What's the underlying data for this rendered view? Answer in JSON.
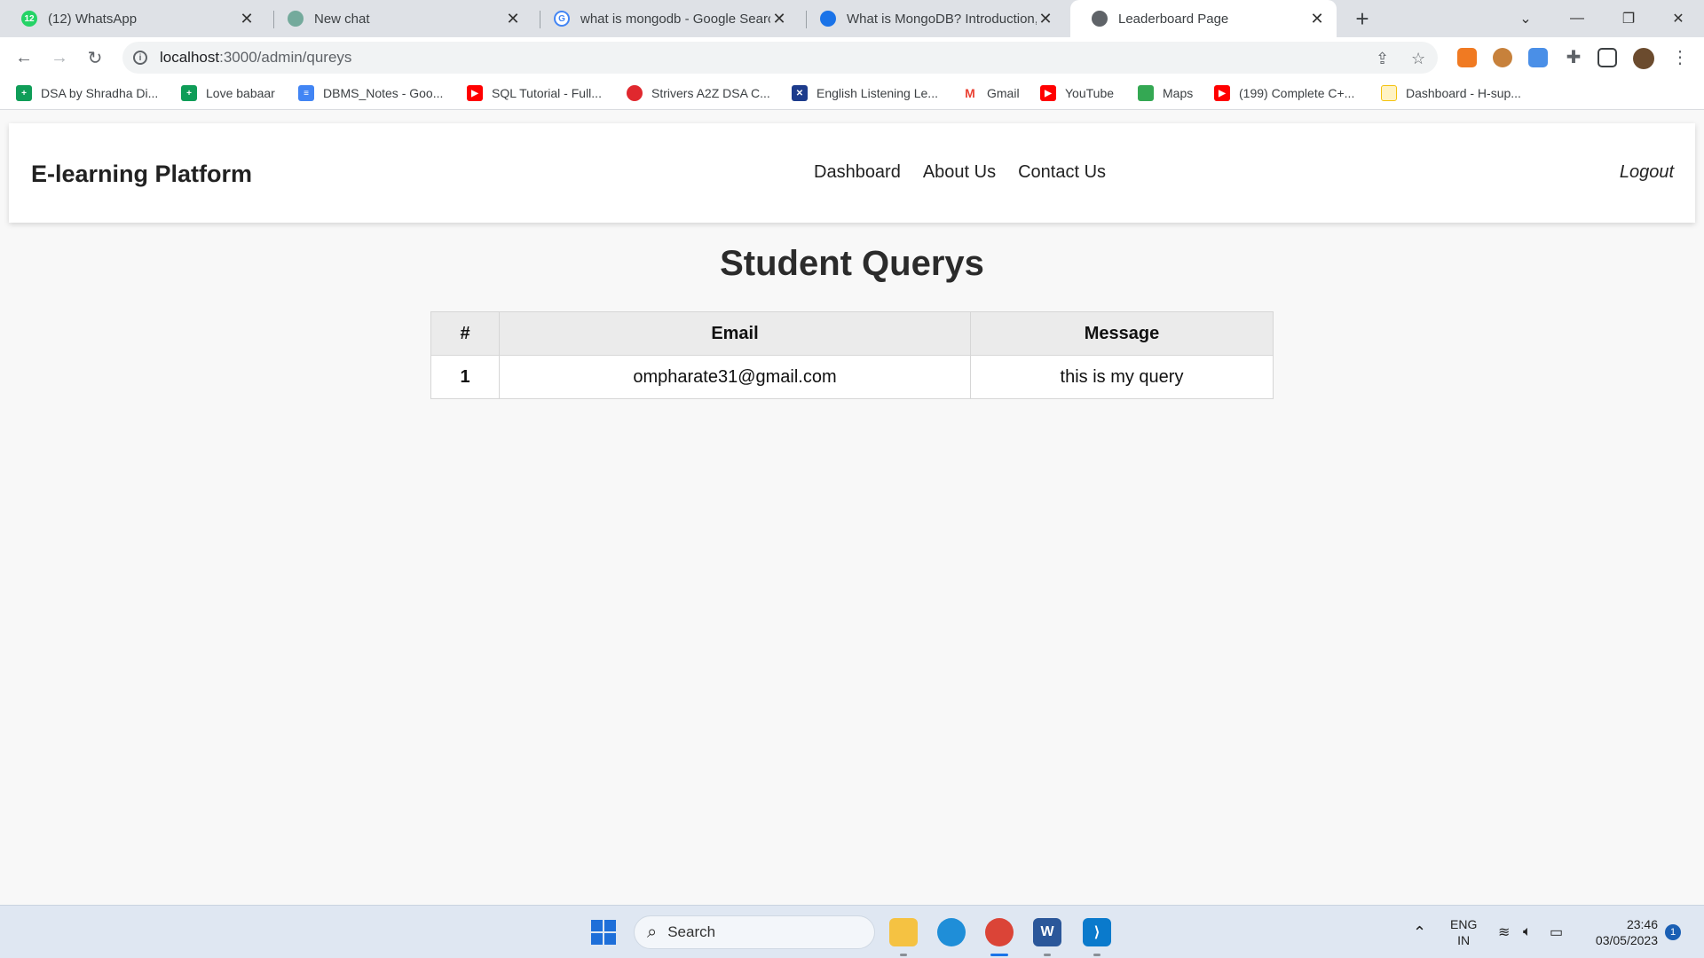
{
  "browser": {
    "tabs": [
      {
        "title": "(12) WhatsApp",
        "icon": "whatsapp-icon",
        "badge": "12",
        "color": "#25d366"
      },
      {
        "title": "New chat",
        "icon": "chatgpt-icon",
        "color": "#74aa9c"
      },
      {
        "title": "what is mongodb - Google Searc",
        "icon": "google-icon",
        "color": "#4285f4"
      },
      {
        "title": "What is MongoDB? Introduction,",
        "icon": "mongodb-site-icon",
        "color": "#1a73e8"
      },
      {
        "title": "Leaderboard Page",
        "icon": "globe-icon",
        "color": "#5f6368",
        "active": true
      }
    ],
    "url": {
      "host": "localhost",
      "path": ":3000/admin/qureys"
    },
    "bookmarks": [
      {
        "label": "DSA by Shradha Di...",
        "icon": "google-sheets-icon",
        "color": "#0f9d58"
      },
      {
        "label": "Love babaar",
        "icon": "google-sheets-icon",
        "color": "#0f9d58"
      },
      {
        "label": "DBMS_Notes - Goo...",
        "icon": "google-docs-icon",
        "color": "#4285f4"
      },
      {
        "label": "SQL Tutorial - Full...",
        "icon": "youtube-icon",
        "color": "#ff0000"
      },
      {
        "label": "Strivers A2Z DSA C...",
        "icon": "tuf-icon",
        "color": "#e0282e"
      },
      {
        "label": "English Listening Le...",
        "icon": "uk-flag-icon",
        "color": "#1d3c8c"
      },
      {
        "label": "Gmail",
        "icon": "gmail-icon",
        "color": "#ea4335"
      },
      {
        "label": "YouTube",
        "icon": "youtube-icon",
        "color": "#ff0000"
      },
      {
        "label": "Maps",
        "icon": "maps-icon",
        "color": "#34a853"
      },
      {
        "label": "(199) Complete C+...",
        "icon": "youtube-icon",
        "color": "#ff0000"
      },
      {
        "label": "Dashboard - H-sup...",
        "icon": "dashboard-icon",
        "color": "#f4c20d"
      }
    ]
  },
  "site": {
    "brand": "E-learning Platform",
    "nav": [
      "Dashboard",
      "About Us",
      "Contact Us"
    ],
    "logout": "Logout"
  },
  "page": {
    "title": "Student Querys",
    "table": {
      "headers": [
        "#",
        "Email",
        "Message"
      ],
      "rows": [
        {
          "num": "1",
          "email": "ompharate31@gmail.com",
          "message": "this is my query"
        }
      ]
    }
  },
  "taskbar": {
    "search_label": "Search",
    "language": "ENG",
    "region": "IN",
    "time": "23:46",
    "date": "03/05/2023",
    "notification_count": "1"
  }
}
